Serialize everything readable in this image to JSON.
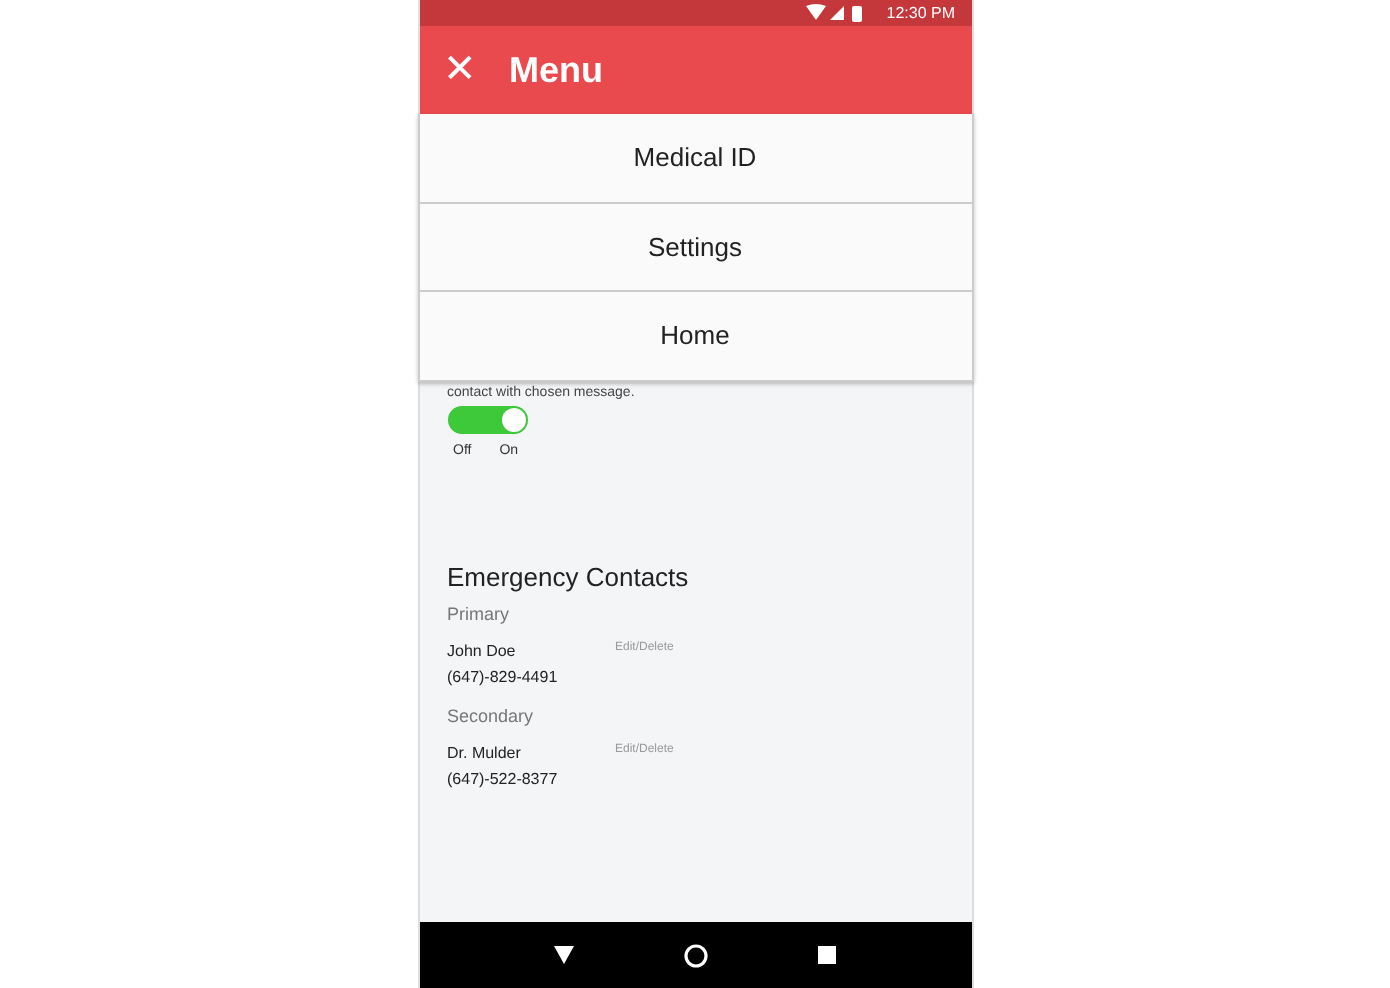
{
  "status_bar": {
    "time": "12:30 PM"
  },
  "app_bar": {
    "close_icon": "✕",
    "title": "Menu"
  },
  "menu": {
    "items": [
      {
        "label": "Medical ID"
      },
      {
        "label": "Settings"
      },
      {
        "label": "Home"
      }
    ]
  },
  "content": {
    "partial_text": "contact with chosen message.",
    "toggle": {
      "on": true,
      "off_label": "Off",
      "on_label": "On"
    },
    "section_title": "Emergency Contacts",
    "contacts": [
      {
        "group": "Primary",
        "name": "John Doe",
        "action": "Edit/Delete",
        "phone": "(647)-829-4491"
      },
      {
        "group": "Secondary",
        "name": "Dr. Mulder",
        "action": "Edit/Delete",
        "phone": "(647)-522-8377"
      }
    ]
  }
}
